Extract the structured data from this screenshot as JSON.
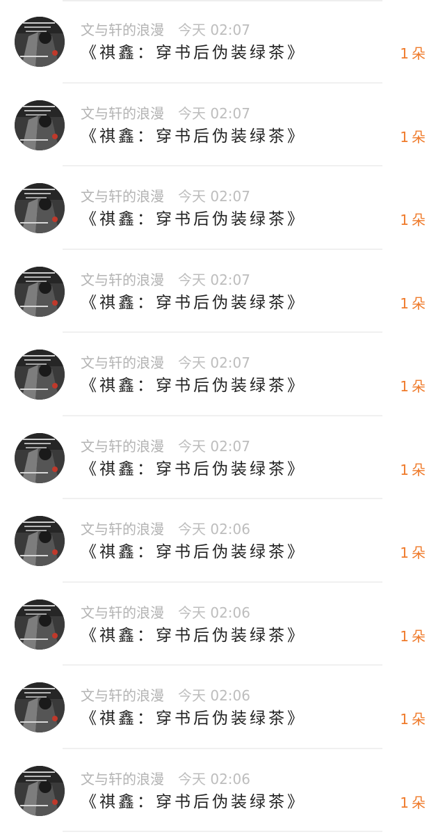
{
  "messages": [
    {
      "sender": "文与轩的浪漫",
      "time": "今天 02:07",
      "title": "《祺鑫：穿书后伪装绿茶》",
      "reward": "1朵"
    },
    {
      "sender": "文与轩的浪漫",
      "time": "今天 02:07",
      "title": "《祺鑫：穿书后伪装绿茶》",
      "reward": "1朵"
    },
    {
      "sender": "文与轩的浪漫",
      "time": "今天 02:07",
      "title": "《祺鑫：穿书后伪装绿茶》",
      "reward": "1朵"
    },
    {
      "sender": "文与轩的浪漫",
      "time": "今天 02:07",
      "title": "《祺鑫：穿书后伪装绿茶》",
      "reward": "1朵"
    },
    {
      "sender": "文与轩的浪漫",
      "time": "今天 02:07",
      "title": "《祺鑫：穿书后伪装绿茶》",
      "reward": "1朵"
    },
    {
      "sender": "文与轩的浪漫",
      "time": "今天 02:07",
      "title": "《祺鑫：穿书后伪装绿茶》",
      "reward": "1朵"
    },
    {
      "sender": "文与轩的浪漫",
      "time": "今天 02:06",
      "title": "《祺鑫：穿书后伪装绿茶》",
      "reward": "1朵"
    },
    {
      "sender": "文与轩的浪漫",
      "time": "今天 02:06",
      "title": "《祺鑫：穿书后伪装绿茶》",
      "reward": "1朵"
    },
    {
      "sender": "文与轩的浪漫",
      "time": "今天 02:06",
      "title": "《祺鑫：穿书后伪装绿茶》",
      "reward": "1朵"
    },
    {
      "sender": "文与轩的浪漫",
      "time": "今天 02:06",
      "title": "《祺鑫：穿书后伪装绿茶》",
      "reward": "1朵"
    }
  ],
  "colors": {
    "reward": "#ef7a2a",
    "meta": "#b3b3b3",
    "title": "#222222"
  }
}
